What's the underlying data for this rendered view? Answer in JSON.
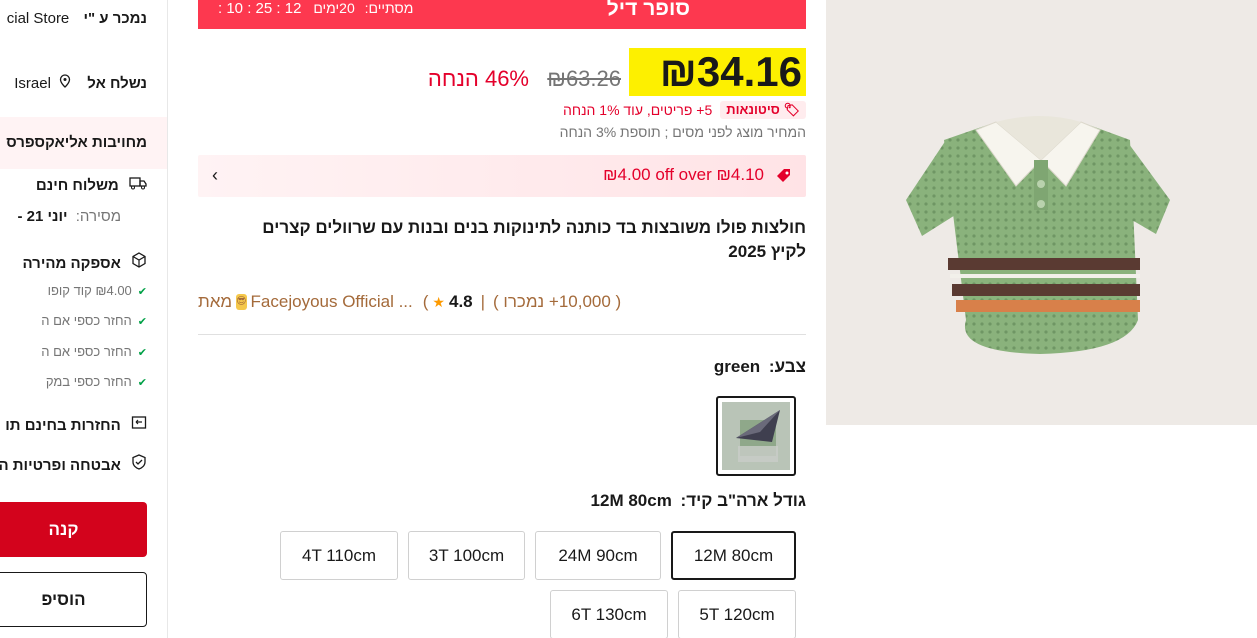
{
  "left_panel": {
    "seller_label": "נמכר ע \"י",
    "store_partial": "cial Store",
    "ship_to_label": "נשלח אל",
    "ship_to_country": "Israel",
    "commitment": "מחויבות אליאקספרס",
    "free_shipping": "משלוח חינם",
    "delivery_label": "מסירה:",
    "delivery_value": "יוני 21 -",
    "fast_delivery": "אספקה מהירה",
    "perks": [
      "₪4.00 קוד קופו",
      "החזר כספי אם ה",
      "החזר כספי אם ה",
      "החזר כספי במק"
    ],
    "free_returns": "החזרות בחינם תו",
    "security": "אבטחה ופרטיות ה",
    "buy_label": "קנה",
    "cart_label": "הוסיפ"
  },
  "deal": {
    "title": "סופר דיל",
    "ends_label": "מסתיים:",
    "days": "20ימים",
    "time": "12 : 25 : 10 :"
  },
  "price": {
    "current": "₪34.16",
    "original": "₪63.26",
    "discount": "46% הנחה",
    "wholesale_badge": "סיטונאות",
    "wholesale_text": "5+ פריטים, עוד 1% הנחה",
    "tax_note": "המחיר מוצג לפני מסים ; תוספת 3% הנחה"
  },
  "coupon": {
    "text": "₪4.00 off over ₪4.10"
  },
  "product": {
    "title": "חולצות פולו משובצות בד כותנה לתינוקות בנים ובנות עם שרוולים קצרים לקיץ 2025",
    "store_prefix": "מאת",
    "store_name": "Facejoyous Official ...",
    "rating": "4.8",
    "sold": "( 10,000+ נמכרו )"
  },
  "color": {
    "label": "צבע:",
    "value": "green"
  },
  "size": {
    "label": "גודל ארה\"ב קיד:",
    "value": "12M 80cm",
    "options": [
      "12M 80cm",
      "24M 90cm",
      "3T 100cm",
      "4T 110cm",
      "5T 120cm",
      "6T 130cm"
    ]
  },
  "colors": {
    "accent_red": "#fd384f",
    "price_highlight": "#fdf000",
    "buy_button": "#d3031c"
  }
}
